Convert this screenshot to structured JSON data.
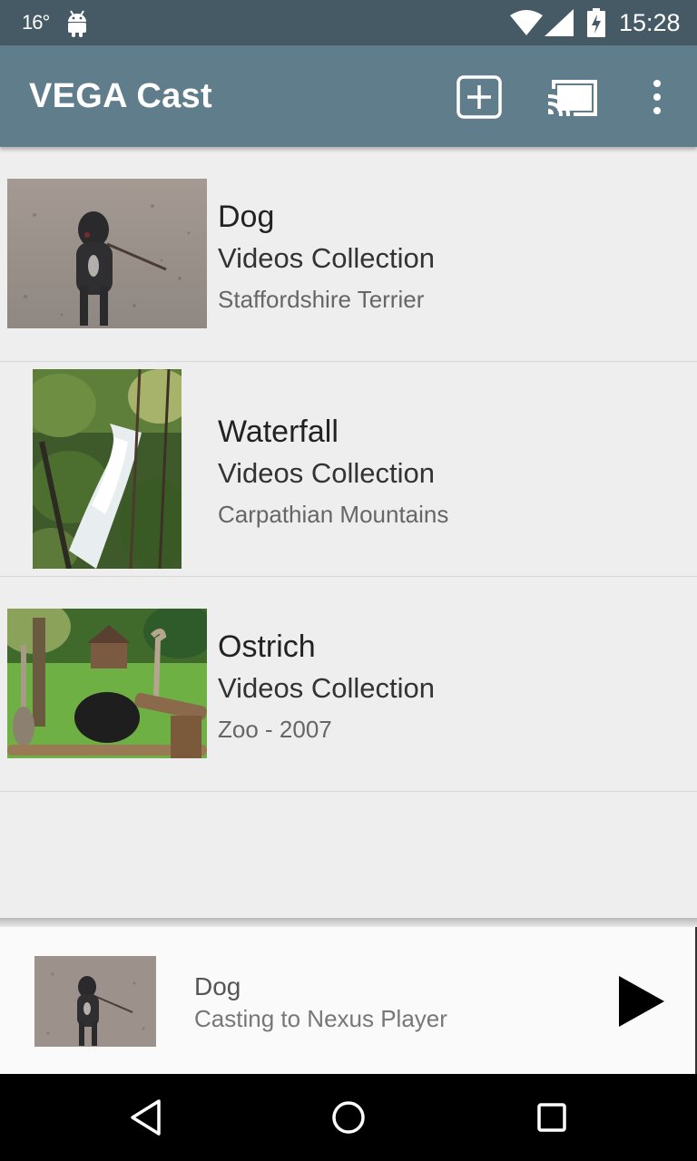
{
  "status_bar": {
    "temperature": "16°",
    "time": "15:28",
    "icons": [
      "android-icon",
      "wifi-icon",
      "signal-icon",
      "battery-charging-icon"
    ]
  },
  "toolbar": {
    "title": "VEGA Cast",
    "icons": [
      "add-box-icon",
      "cast-icon",
      "more-vert-icon"
    ]
  },
  "videos": [
    {
      "title": "Dog",
      "studio": "Videos Collection",
      "subtitle": "Staffordshire Terrier"
    },
    {
      "title": "Waterfall",
      "studio": "Videos Collection",
      "subtitle": "Carpathian Mountains"
    },
    {
      "title": "Ostrich",
      "studio": "Videos Collection",
      "subtitle": "Zoo - 2007"
    }
  ],
  "mini_controller": {
    "title": "Dog",
    "subtitle": "Casting to Nexus Player",
    "icons": [
      "play-icon"
    ]
  },
  "nav_bar": {
    "icons": [
      "back-icon",
      "home-icon",
      "recents-icon"
    ]
  },
  "colors": {
    "status_bar": "#455a64",
    "toolbar": "#607d8b",
    "background": "#eeeeee"
  }
}
